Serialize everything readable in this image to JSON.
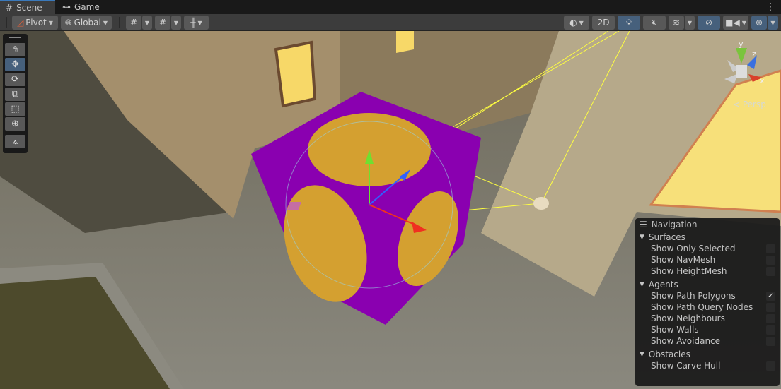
{
  "tabs": [
    {
      "label": "Scene",
      "icon": "grid-icon"
    },
    {
      "label": "Game",
      "icon": "gamepad-icon"
    }
  ],
  "toolbar": {
    "pivot": "Pivot",
    "global": "Global",
    "two_d": "2D"
  },
  "tools": [
    "hand-tool",
    "move-tool",
    "rotate-tool",
    "scale-tool",
    "rect-tool",
    "transform-tool",
    "custom-tool"
  ],
  "gizmo": {
    "y": "y",
    "z": "z",
    "x": "x",
    "projection": "< Persp"
  },
  "navigation": {
    "title": "Navigation",
    "groups": [
      {
        "label": "Surfaces",
        "items": [
          {
            "label": "Show Only Selected",
            "checked": false
          },
          {
            "label": "Show NavMesh",
            "checked": false
          },
          {
            "label": "Show HeightMesh",
            "checked": false
          }
        ]
      },
      {
        "label": "Agents",
        "items": [
          {
            "label": "Show Path Polygons",
            "checked": true
          },
          {
            "label": "Show Path Query Nodes",
            "checked": false
          },
          {
            "label": "Show Neighbours",
            "checked": false
          },
          {
            "label": "Show Walls",
            "checked": false
          },
          {
            "label": "Show Avoidance",
            "checked": false
          }
        ]
      },
      {
        "label": "Obstacles",
        "items": [
          {
            "label": "Show Carve Hull",
            "checked": false
          }
        ]
      }
    ]
  },
  "colors": {
    "accent": "#3a79bb",
    "toggle_on": "#46607c",
    "cube": "#8a00b0",
    "circle": "#d4a030"
  }
}
